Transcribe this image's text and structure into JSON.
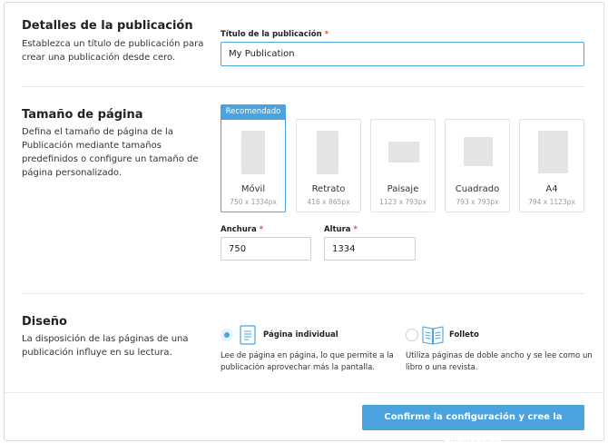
{
  "details": {
    "title": "Detalles de la publicación",
    "description_line1": "Establezca un título de publicación para",
    "description_line2": "crear una publicación desde cero.",
    "field_label": "Título de la publicación",
    "required_mark": "*",
    "title_value": "My Publication"
  },
  "page_size": {
    "title": "Tamaño de página",
    "description_line1": "Defina el tamaño de página de la",
    "description_line2": "Publicación mediante tamaños",
    "description_line3": "predefinidos o configure un tamaño de",
    "description_line4": "página personalizado.",
    "recommended_badge": "Recomendado",
    "sizes": [
      {
        "name": "Móvil",
        "dims": "750 x 1334px",
        "selected": true
      },
      {
        "name": "Retrato",
        "dims": "416 x 865px",
        "selected": false
      },
      {
        "name": "Paisaje",
        "dims": "1123 x 793px",
        "selected": false
      },
      {
        "name": "Cuadrado",
        "dims": "793 x 793px",
        "selected": false
      },
      {
        "name": "A4",
        "dims": "794 x 1123px",
        "selected": false
      }
    ],
    "width_label": "Anchura",
    "width_value": "750",
    "height_label": "Altura",
    "height_value": "1334"
  },
  "layout": {
    "title": "Diseño",
    "description_line1": "La disposición de las páginas de una",
    "description_line2": "publicación influye en su lectura.",
    "options": [
      {
        "title": "Página individual",
        "desc_line1": "Lee de página en página, lo que permite a la",
        "desc_line2": "publicación aprovechar más la pantalla.",
        "selected": true,
        "icon": "single-page-icon"
      },
      {
        "title": "Folleto",
        "desc_line1": "Utiliza páginas de doble ancho y se lee como un",
        "desc_line2": "libro o una revista.",
        "selected": false,
        "icon": "booklet-icon"
      }
    ]
  },
  "footer": {
    "confirm_label": "Confirme la configuración y cree la publicación"
  },
  "colors": {
    "accent": "#4aa3df",
    "required": "#e04b4b"
  }
}
